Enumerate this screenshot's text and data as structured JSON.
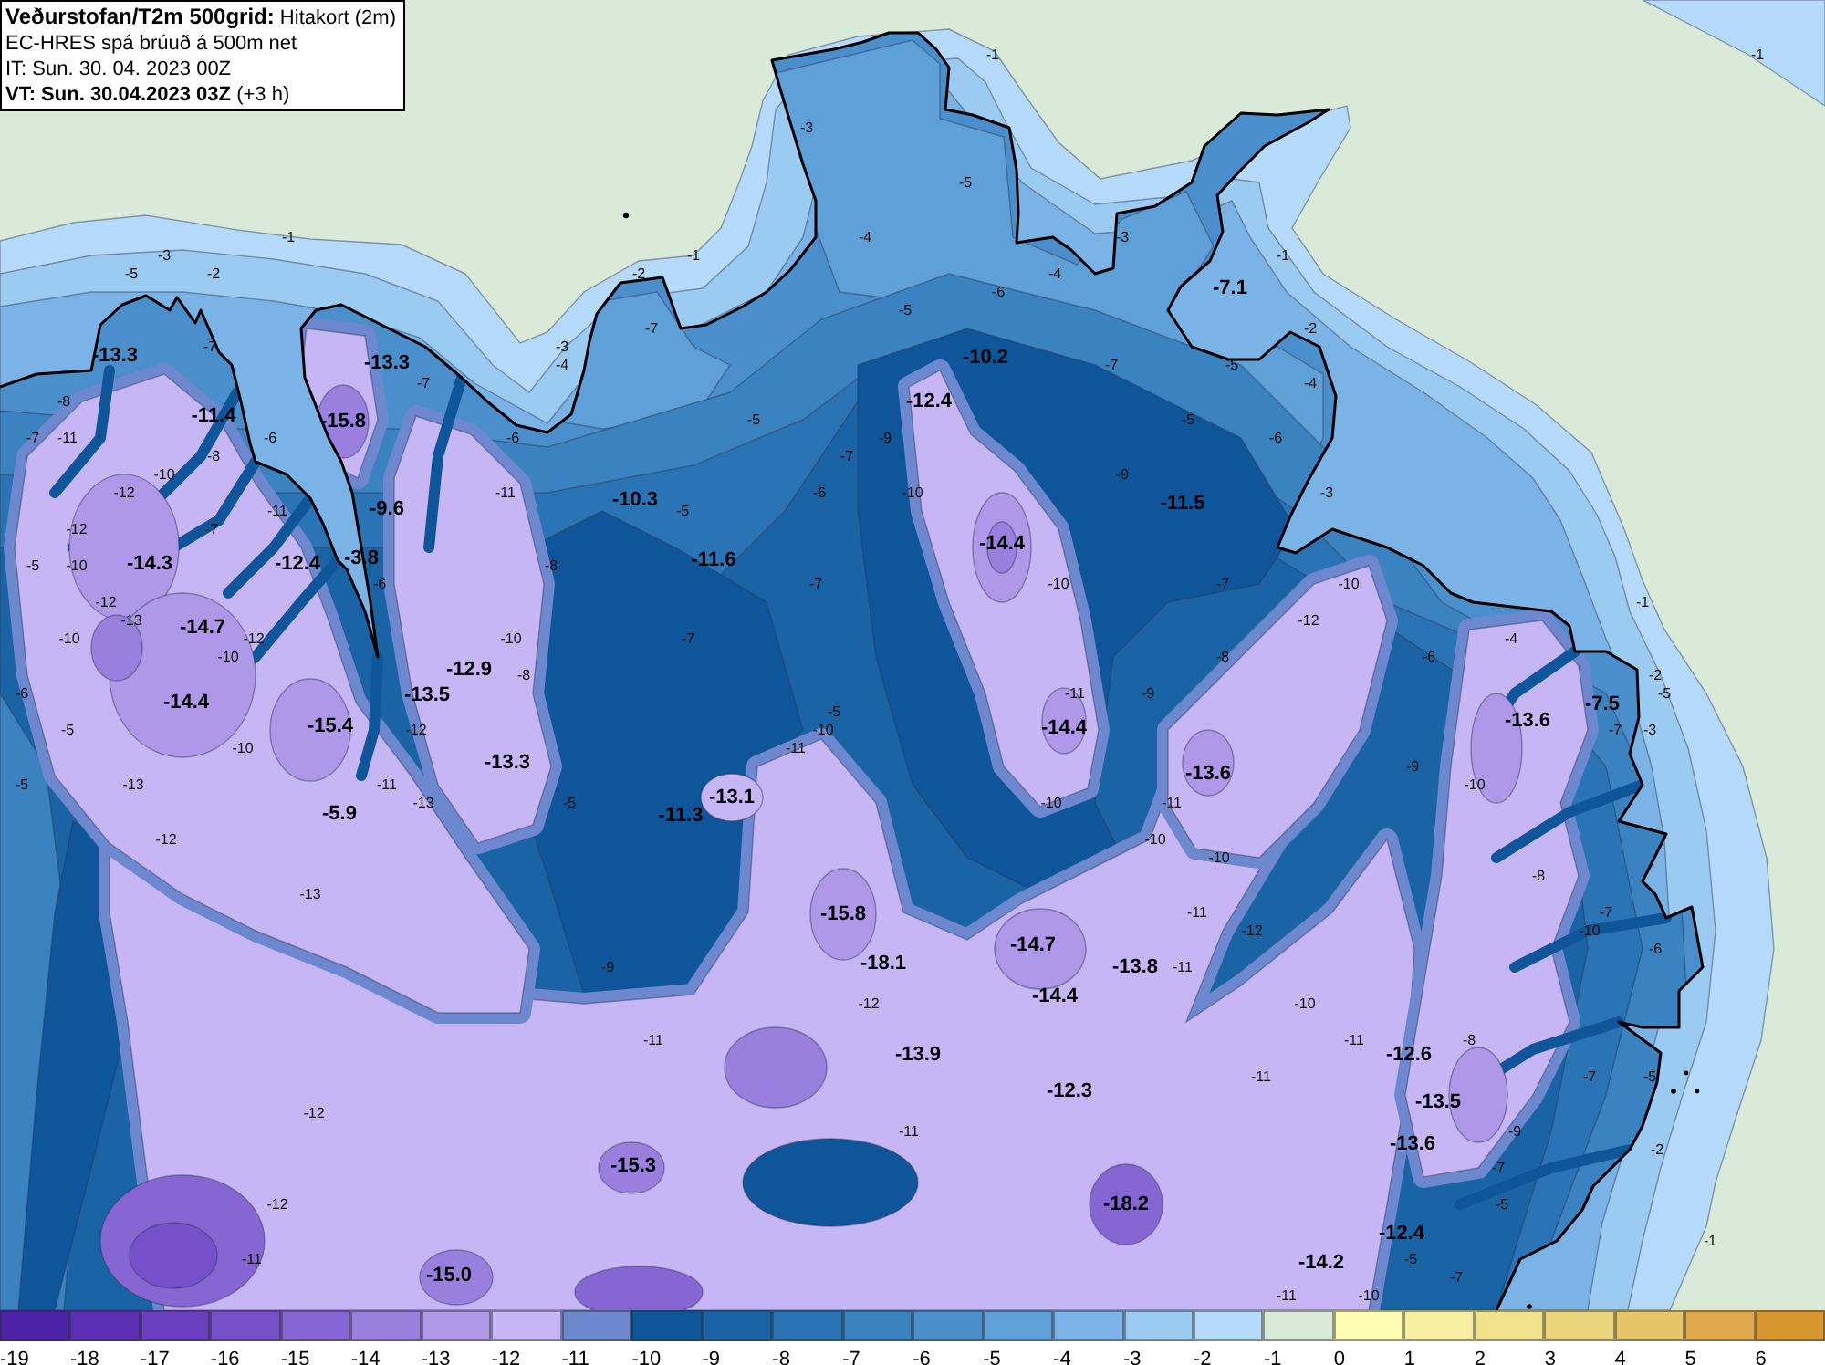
{
  "title_panel": {
    "title": "**Veðurstofan/T2m 500grid:** Hitakort (2m)",
    "model": "EC-HRES spá brúuð á 500m net",
    "init_time": "IT: Sun. 30. 04. 2023 00Z",
    "valid_time": "**VT: Sun. 30.04.2023 03Z** (+3 h)"
  },
  "map": {
    "extrema_labels": [
      "-7.1",
      "-13.3",
      "-13.3",
      "-10.2",
      "-11.4",
      "-15.8",
      "-12.4",
      "-9.6",
      "-10.3",
      "-11.5",
      "-14.3",
      "-12.4",
      "-3.8",
      "-11.6",
      "-14.4",
      "-14.7",
      "-12.9",
      "-14.4",
      "-13.5",
      "-7.5",
      "-15.4",
      "-14.4",
      "-13.6",
      "-13.3",
      "-13.6",
      "-5.9",
      "-11.3",
      "-13.1",
      "-15.8",
      "-14.7",
      "-18.1",
      "-13.8",
      "-14.4",
      "-13.9",
      "-12.6",
      "-12.3",
      "-13.5",
      "-13.6",
      "-15.3",
      "-18.2",
      "-12.4",
      "-15.0",
      "-14.2"
    ],
    "contour_labels": [
      "-1",
      "-1",
      "-3",
      "-5",
      "-1",
      "-4",
      "-3",
      "-3",
      "-1",
      "-1",
      "-5",
      "-2",
      "-2",
      "-4",
      "-6",
      "-5",
      "-7",
      "-2",
      "-7",
      "-3",
      "-4",
      "-7",
      "-5",
      "-7",
      "-4",
      "-8",
      "-5",
      "-5",
      "-7",
      "-11",
      "-6",
      "-6",
      "-9",
      "-6",
      "-8",
      "-7",
      "-10",
      "-9",
      "-12",
      "-11",
      "-6",
      "-10",
      "-3",
      "-11",
      "-5",
      "-12",
      "-7",
      "-5",
      "-10",
      "-8",
      "-6",
      "-7",
      "-10",
      "-7",
      "-10",
      "-12",
      "-1",
      "-13",
      "-12",
      "-10",
      "-12",
      "-10",
      "-7",
      "-4",
      "-10",
      "-8",
      "-6",
      "-8",
      "-2",
      "-6",
      "-11",
      "-9",
      "-5",
      "-5",
      "-5",
      "-12",
      "-10",
      "-7",
      "-3",
      "-10",
      "-11",
      "-9",
      "-5",
      "-13",
      "-11",
      "-10",
      "-13",
      "-5",
      "-10",
      "-11",
      "-12",
      "-10",
      "-10",
      "-8",
      "-13",
      "-11",
      "-7",
      "-12",
      "-10",
      "-6",
      "-9",
      "-11",
      "-12",
      "-10",
      "-11",
      "-11",
      "-8",
      "-11",
      "-7",
      "-5",
      "-12",
      "-11",
      "-9",
      "-2",
      "-7",
      "-12",
      "-5",
      "-1",
      "-11",
      "-5",
      "-7",
      "-11",
      "-10"
    ]
  },
  "colorbar": {
    "items": [
      {
        "label": "-19",
        "color": "#4c23a6"
      },
      {
        "label": "-18",
        "color": "#5a2fb4"
      },
      {
        "label": "-17",
        "color": "#6a3fbf"
      },
      {
        "label": "-16",
        "color": "#7650c8"
      },
      {
        "label": "-15",
        "color": "#8566d2"
      },
      {
        "label": "-14",
        "color": "#9a80de"
      },
      {
        "label": "-13",
        "color": "#af98e8"
      },
      {
        "label": "-12",
        "color": "#c6b6f5"
      },
      {
        "label": "-11",
        "color": "#6d88cf"
      },
      {
        "label": "-10",
        "color": "#0f5599"
      },
      {
        "label": "-9",
        "color": "#1a64a6"
      },
      {
        "label": "-8",
        "color": "#2a73b4"
      },
      {
        "label": "-7",
        "color": "#3a82c0"
      },
      {
        "label": "-6",
        "color": "#4a8fcc"
      },
      {
        "label": "-5",
        "color": "#5fa0d8"
      },
      {
        "label": "-4",
        "color": "#7cb3e6"
      },
      {
        "label": "-3",
        "color": "#9ccbf2"
      },
      {
        "label": "-2",
        "color": "#b6dafc"
      },
      {
        "label": "-1",
        "color": "#d9ebd8"
      },
      {
        "label": "0",
        "color": "#fefdb2"
      },
      {
        "label": "1",
        "color": "#f7f0a2"
      },
      {
        "label": "2",
        "color": "#f0e38c"
      },
      {
        "label": "3",
        "color": "#ebd57c"
      },
      {
        "label": "4",
        "color": "#e6c468"
      },
      {
        "label": "5",
        "color": "#e0aa4c"
      },
      {
        "label": "6",
        "color": "#d8972e"
      }
    ]
  }
}
